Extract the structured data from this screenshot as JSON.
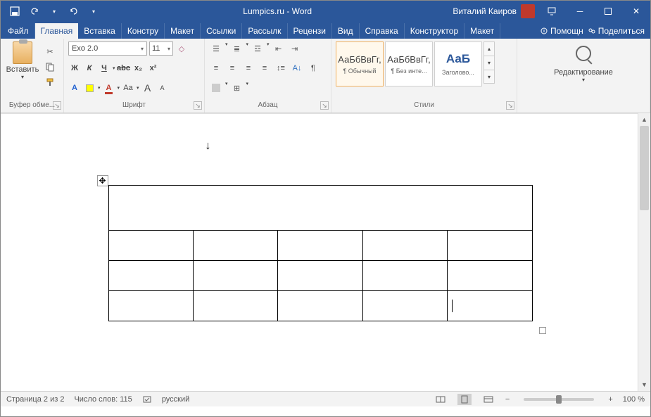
{
  "title": "Lumpics.ru  -  Word",
  "user_name": "Виталий Каиров",
  "tabs": {
    "file": "Файл",
    "home": "Главная",
    "insert": "Вставка",
    "design": "Констру",
    "layout": "Макет",
    "references": "Ссылки",
    "mailings": "Рассылк",
    "review": "Рецензи",
    "view": "Вид",
    "help": "Справка",
    "table_design": "Конструктор",
    "table_layout": "Макет",
    "tell_me": "Помощн",
    "share": "Поделиться"
  },
  "ribbon": {
    "clipboard": {
      "paste": "Вставить",
      "label": "Буфер обме..."
    },
    "font": {
      "name": "Exo 2.0",
      "size": "11",
      "label": "Шрифт",
      "bold_fmt": "Ж",
      "italic_fmt": "К",
      "underline_fmt": "Ч",
      "strike": "abc",
      "sub": "x₂",
      "sup": "x²",
      "texteffects": "A",
      "clear": "Aa",
      "grow": "A",
      "shrink": "A"
    },
    "paragraph": {
      "label": "Абзац",
      "pilcrow": "¶"
    },
    "styles": {
      "label": "Стили",
      "items": [
        {
          "sample": "АаБбВвГг,",
          "name": "¶ Обычный"
        },
        {
          "sample": "АаБбВвГг,",
          "name": "¶ Без инте..."
        },
        {
          "sample": "АаБ",
          "name": "Заголово..."
        }
      ]
    },
    "editing": {
      "label": "Редактирование"
    }
  },
  "statusbar": {
    "page": "Страница 2 из 2",
    "words": "Число слов: 115",
    "lang": "русский",
    "zoom": "100 %"
  }
}
